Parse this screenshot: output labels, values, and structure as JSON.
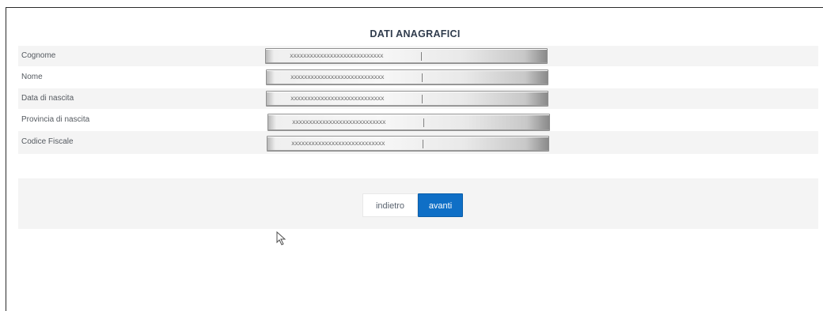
{
  "form": {
    "title": "DATI ANAGRAFICI",
    "rows": [
      {
        "label": "Cognome",
        "value": "xxxxxxxxxxxxxxxxxxxxxxxxxxxx"
      },
      {
        "label": "Nome",
        "value": "xxxxxxxxxxxxxxxxxxxxxxxxxxxx"
      },
      {
        "label": "Data di nascita",
        "value": "xxxxxxxxxxxxxxxxxxxxxxxxxxxx"
      },
      {
        "label": "Provincia di nascita",
        "value": "xxxxxxxxxxxxxxxxxxxxxxxxxxxx"
      },
      {
        "label": "Codice Fiscale",
        "value": "xxxxxxxxxxxxxxxxxxxxxxxxxxxx"
      }
    ]
  },
  "actions": {
    "back_label": "indietro",
    "next_label": "avanti"
  },
  "colors": {
    "primary_button": "#0f6fc6",
    "row_stripe": "#f4f4f4",
    "title_text": "#2f3b4c"
  },
  "icons": {
    "cursor": "mouse-pointer-icon"
  }
}
